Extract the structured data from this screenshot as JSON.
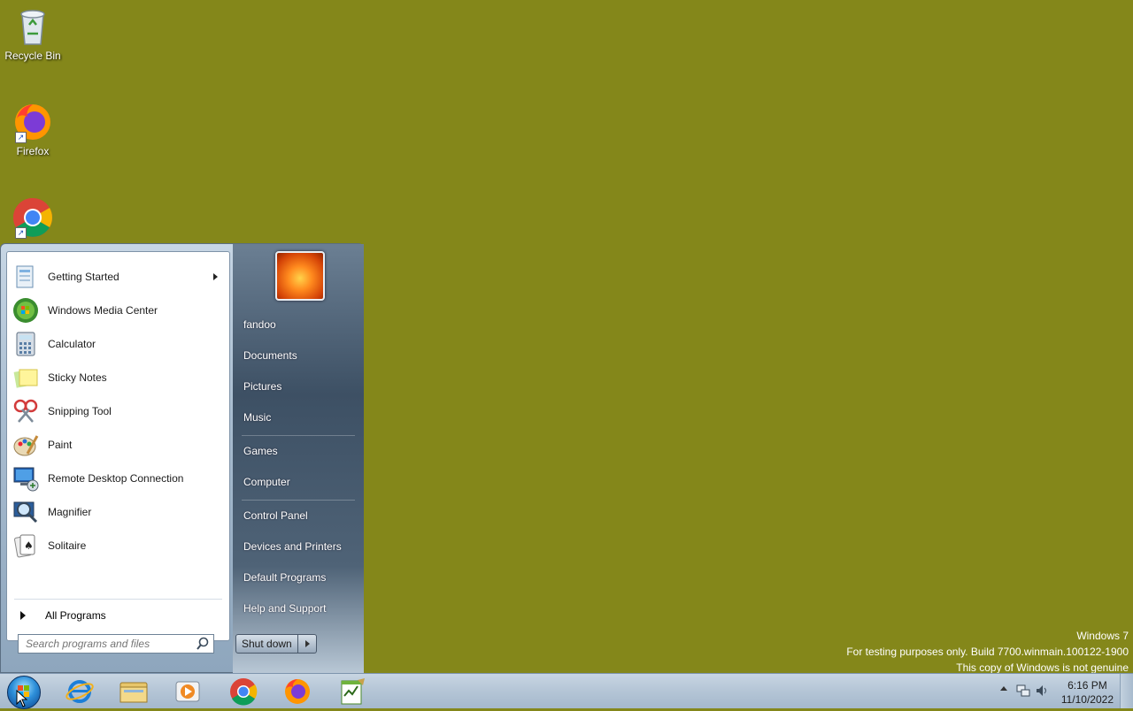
{
  "desktop": {
    "icons": [
      {
        "label": "Recycle Bin",
        "icon": "recycle-bin-icon"
      },
      {
        "label": "Firefox",
        "icon": "firefox-icon"
      },
      {
        "label": "",
        "icon": "chrome-icon"
      }
    ],
    "background_color": "#84871a"
  },
  "start_menu": {
    "programs": [
      {
        "label": "Getting Started",
        "icon": "getting-started-icon",
        "has_submenu": true
      },
      {
        "label": "Windows Media Center",
        "icon": "media-center-icon"
      },
      {
        "label": "Calculator",
        "icon": "calculator-icon"
      },
      {
        "label": "Sticky Notes",
        "icon": "sticky-notes-icon"
      },
      {
        "label": "Snipping Tool",
        "icon": "snipping-tool-icon"
      },
      {
        "label": "Paint",
        "icon": "paint-icon"
      },
      {
        "label": "Remote Desktop Connection",
        "icon": "remote-desktop-icon"
      },
      {
        "label": "Magnifier",
        "icon": "magnifier-icon"
      },
      {
        "label": "Solitaire",
        "icon": "solitaire-icon"
      }
    ],
    "all_programs": "All Programs",
    "search_placeholder": "Search programs and files",
    "right_items": {
      "user": "fandoo",
      "documents": "Documents",
      "pictures": "Pictures",
      "music": "Music",
      "games": "Games",
      "computer": "Computer",
      "control_panel": "Control Panel",
      "devices": "Devices and Printers",
      "default_programs": "Default Programs",
      "help": "Help and Support"
    },
    "shutdown_label": "Shut down"
  },
  "watermark": {
    "line1": "Windows 7",
    "line2": "For testing purposes only. Build 7700.winmain.100122-1900",
    "line3": "This copy of Windows is not genuine"
  },
  "taskbar": {
    "pinned": [
      "internet-explorer-icon",
      "windows-explorer-icon",
      "media-player-icon",
      "chrome-icon",
      "firefox-icon",
      "notepad-icon"
    ],
    "clock_time": "6:16 PM",
    "clock_date": "11/10/2022"
  }
}
